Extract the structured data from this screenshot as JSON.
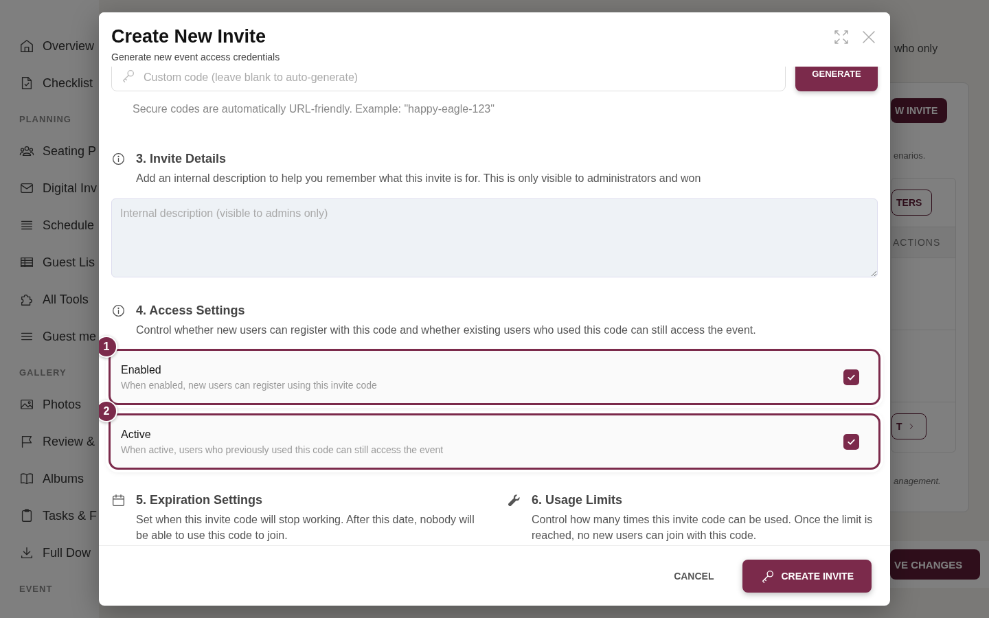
{
  "sidebar": {
    "items": [
      {
        "kind": "item",
        "label": "Overview"
      },
      {
        "kind": "item",
        "label": "Checklist"
      },
      {
        "kind": "heading",
        "label": "PLANNING"
      },
      {
        "kind": "item",
        "label": "Seating P"
      },
      {
        "kind": "item",
        "label": "Digital Inv"
      },
      {
        "kind": "item",
        "label": "Schedule"
      },
      {
        "kind": "item",
        "label": "Guest Lis"
      },
      {
        "kind": "item",
        "label": "All Tools"
      },
      {
        "kind": "item",
        "label": "Guest me"
      },
      {
        "kind": "heading",
        "label": "GALLERY"
      },
      {
        "kind": "item",
        "label": "Photos"
      },
      {
        "kind": "item",
        "label": "Review &"
      },
      {
        "kind": "item",
        "label": "Albums"
      },
      {
        "kind": "item",
        "label": "Tasks & F"
      },
      {
        "kind": "item",
        "label": "Full Dow"
      },
      {
        "kind": "heading",
        "label": "EVENT"
      }
    ]
  },
  "background": {
    "intro": "who only",
    "new_button": "W INVITE",
    "note": "enarios.",
    "filter_button": "TERS",
    "column": "ACTIONS",
    "next_button": "T",
    "footnote": "anagement.",
    "save_button": "VE CHANGES"
  },
  "modal": {
    "title": "Create New Invite",
    "subtitle": "Generate new event access credentials",
    "code_field": {
      "placeholder": "Custom code (leave blank to auto-generate)"
    },
    "generate_button": "GENERATE",
    "code_hint": "Secure codes are automatically URL-friendly. Example: \"happy-eagle-123\"",
    "details": {
      "title": "3. Invite Details",
      "description": "Add an internal description to help you remember what this invite is for. This is only visible to administrators and won",
      "placeholder": "Internal description (visible to admins only)"
    },
    "access": {
      "title": "4. Access Settings",
      "description": "Control whether new users can register with this code and whether existing users who used this code can still access the event.",
      "options": [
        {
          "badge": "1",
          "label": "Enabled",
          "hint": "When enabled, new users can register using this invite code",
          "checked": true
        },
        {
          "badge": "2",
          "label": "Active",
          "hint": "When active, users who previously used this code can still access the event",
          "checked": true
        }
      ]
    },
    "columns": [
      {
        "kind": "calendar",
        "title": "5. Expiration Settings",
        "description": "Set when this invite code will stop working. After this date, nobody will be able to use this code to join."
      },
      {
        "kind": "wrench",
        "title": "6. Usage Limits",
        "description": "Control how many times this invite code can be used. Once the limit is reached, no new users can join with this code."
      }
    ],
    "cancel_button": "CANCEL",
    "create_button": "CREATE INVITE"
  }
}
